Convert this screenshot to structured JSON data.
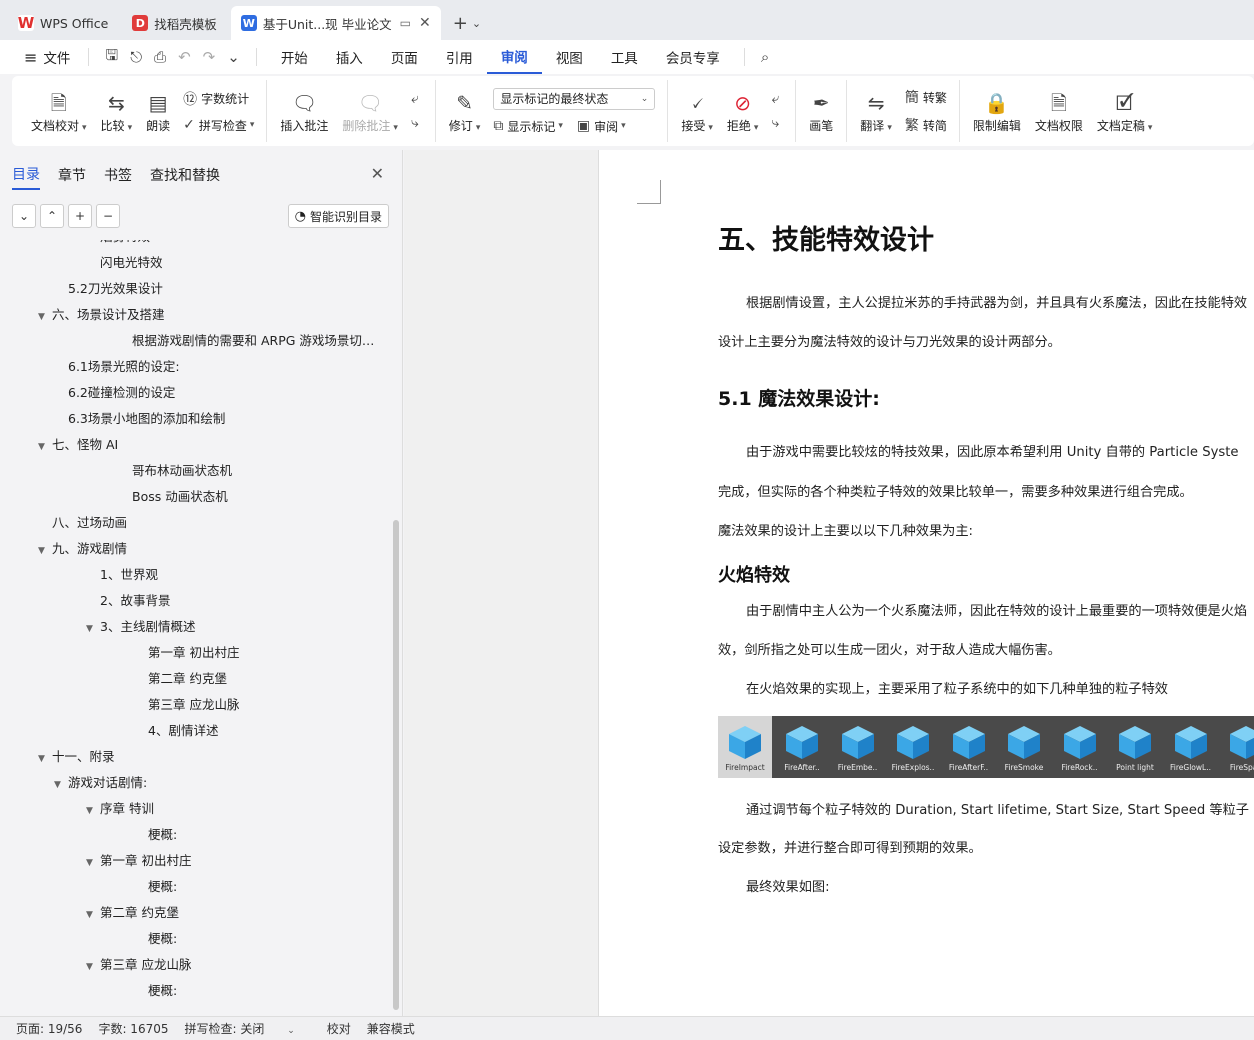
{
  "tabs": [
    {
      "label": "WPS Office",
      "icon": "wps-logo-icon"
    },
    {
      "label": "找稻壳模板",
      "icon": "docer-icon"
    },
    {
      "label": "基于Unit...现 毕业论文",
      "icon": "word-doc-icon",
      "active": true
    }
  ],
  "menu": {
    "file": "文件",
    "items": [
      "开始",
      "插入",
      "页面",
      "引用",
      "审阅",
      "视图",
      "工具",
      "会员专享"
    ],
    "active": "审阅"
  },
  "ribbon": {
    "doc_check": "文档校对",
    "compare": "比较",
    "read_aloud": "朗读",
    "word_count": "字数统计",
    "spell_check": "拼写检查",
    "insert_comment": "插入批注",
    "delete_comment": "删除批注",
    "track": "修订",
    "markup_dropdown": "显示标记的最终状态",
    "show_markup": "显示标记",
    "review": "审阅",
    "accept": "接受",
    "reject": "拒绝",
    "pen": "画笔",
    "translate": "翻译",
    "to_traditional": "转繁",
    "to_simplified": "转简",
    "restrict_edit": "限制编辑",
    "doc_permission": "文档权限",
    "doc_finalize": "文档定稿"
  },
  "sidebar": {
    "tabs": [
      "目录",
      "章节",
      "书签",
      "查找和替换"
    ],
    "active_tab": "目录",
    "smart_toc": "智能识别目录",
    "toc": [
      {
        "text": "烟雾特效",
        "level": 3,
        "arrow": false,
        "partial": true
      },
      {
        "text": "闪电光特效",
        "level": 3,
        "arrow": false
      },
      {
        "text": "5.2刀光效果设计",
        "level": 2,
        "arrow": false
      },
      {
        "text": "六、场景设计及搭建",
        "level": 1,
        "arrow": true
      },
      {
        "text": "根据游戏剧情的需要和 ARPG 游戏场景切换…",
        "level": 4,
        "arrow": false
      },
      {
        "text": "6.1场景光照的设定:",
        "level": 2,
        "arrow": false
      },
      {
        "text": "6.2碰撞检测的设定",
        "level": 2,
        "arrow": false
      },
      {
        "text": "6.3场景小地图的添加和绘制",
        "level": 2,
        "arrow": false
      },
      {
        "text": "七、怪物 AI",
        "level": 1,
        "arrow": true
      },
      {
        "text": "哥布林动画状态机",
        "level": 4,
        "arrow": false
      },
      {
        "text": "Boss 动画状态机",
        "level": 4,
        "arrow": false
      },
      {
        "text": "八、过场动画",
        "level": 1,
        "arrow": false
      },
      {
        "text": "九、游戏剧情",
        "level": 1,
        "arrow": true
      },
      {
        "text": "1、世界观",
        "level": 3,
        "arrow": false
      },
      {
        "text": "2、故事背景",
        "level": 3,
        "arrow": false
      },
      {
        "text": "3、主线剧情概述",
        "level": 3,
        "arrow": true
      },
      {
        "text": "第一章 初出村庄",
        "level": 5,
        "arrow": false
      },
      {
        "text": "第二章 约克堡",
        "level": 5,
        "arrow": false
      },
      {
        "text": "第三章 应龙山脉",
        "level": 5,
        "arrow": false
      },
      {
        "text": "4、剧情详述",
        "level": 5,
        "arrow": false
      },
      {
        "text": "十一、附录",
        "level": 1,
        "arrow": true
      },
      {
        "text": "游戏对话剧情:",
        "level": 2,
        "arrow": true
      },
      {
        "text": "序章 特训",
        "level": 3,
        "arrow": true
      },
      {
        "text": "梗概:",
        "level": 5,
        "arrow": false
      },
      {
        "text": "第一章 初出村庄",
        "level": 3,
        "arrow": true
      },
      {
        "text": "梗概:",
        "level": 5,
        "arrow": false
      },
      {
        "text": "第二章 约克堡",
        "level": 3,
        "arrow": true
      },
      {
        "text": "梗概:",
        "level": 5,
        "arrow": false
      },
      {
        "text": "第三章 应龙山脉",
        "level": 3,
        "arrow": true
      },
      {
        "text": "梗概:",
        "level": 5,
        "arrow": false
      }
    ]
  },
  "document": {
    "h1": "五、技能特效设计",
    "p1": "根据剧情设置，主人公提拉米苏的手持武器为剑，并且具有火系魔法，因此在技能特效",
    "p2": "设计上主要分为魔法特效的设计与刀光效果的设计两部分。",
    "h2": "5.1  魔法效果设计:",
    "p3": "由于游戏中需要比较炫的特技效果，因此原本希望利用 Unity 自带的 Particle Syste",
    "p4": "完成，但实际的各个种类粒子特效的效果比较单一，需要多种效果进行组合完成。",
    "p5": "魔法效果的设计上主要以以下几种效果为主:",
    "h3": "火焰特效",
    "p6": "由于剧情中主人公为一个火系魔法师，因此在特效的设计上最重要的一项特效便是火焰",
    "p7": "效，剑所指之处可以生成一团火，对于敌人造成大幅伤害。",
    "p8": "在火焰效果的实现上，主要采用了粒子系统中的如下几种单独的粒子特效",
    "prefabs": [
      "FireImpact",
      "FireAfter..",
      "FireEmbe..",
      "FireExplos..",
      "FireAfterF..",
      "FireSmoke",
      "FireRock..",
      "Point light",
      "FireGlowL..",
      "FireSpa.."
    ],
    "p9": "通过调节每个粒子特效的 Duration, Start lifetime, Start Size, Start Speed 等粒子",
    "p10": "设定参数，并进行整合即可得到预期的效果。",
    "p11": "最终效果如图:"
  },
  "status": {
    "page": "页面: 19/56",
    "words": "字数: 16705",
    "spell": "拼写检查: 关闭",
    "proof": "校对",
    "compat": "兼容模式"
  }
}
